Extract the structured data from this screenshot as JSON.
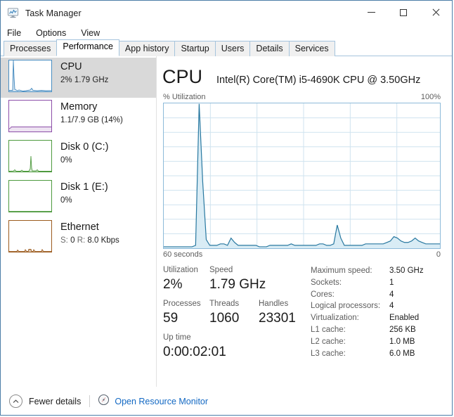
{
  "window": {
    "title": "Task Manager",
    "icon": "task-manager-icon",
    "controls": {
      "minimize": "–",
      "maximize": "☐",
      "close": "✕"
    }
  },
  "menu": {
    "items": [
      "File",
      "Options",
      "View"
    ]
  },
  "tabs": [
    {
      "label": "Processes",
      "active": false
    },
    {
      "label": "Performance",
      "active": true
    },
    {
      "label": "App history",
      "active": false
    },
    {
      "label": "Startup",
      "active": false
    },
    {
      "label": "Users",
      "active": false
    },
    {
      "label": "Details",
      "active": false
    },
    {
      "label": "Services",
      "active": false
    }
  ],
  "sidebar": {
    "items": [
      {
        "name": "CPU",
        "title": "CPU",
        "subtitle": "2%  1.79 GHz",
        "selected": true,
        "color": "#4a8ec2",
        "fill": "rgba(74,142,194,0.18)"
      },
      {
        "name": "Memory",
        "title": "Memory",
        "subtitle": "1.1/7.9 GB (14%)",
        "selected": false,
        "color": "#8c4ea8",
        "fill": "rgba(140,78,168,0.15)"
      },
      {
        "name": "Disk 0 (C:)",
        "title": "Disk 0 (C:)",
        "subtitle": "0%",
        "selected": false,
        "color": "#4e9a3e",
        "fill": "rgba(78,154,62,0.18)"
      },
      {
        "name": "Disk 1 (E:)",
        "title": "Disk 1 (E:)",
        "subtitle": "0%",
        "selected": false,
        "color": "#4e9a3e",
        "fill": "rgba(78,154,62,0.18)"
      },
      {
        "name": "Ethernet",
        "title": "Ethernet",
        "subtitle_parts": {
          "send_label": "S:",
          "send": "0",
          "recv_label": "R:",
          "recv": "8.0 Kbps"
        },
        "subtitle": "S: 0 R: 8.0 Kbps",
        "selected": false,
        "color": "#9c5b1e",
        "fill": "rgba(156,91,30,0.20)"
      }
    ]
  },
  "main": {
    "heading": "CPU",
    "model": "Intel(R) Core(TM) i5-4690K CPU @ 3.50GHz",
    "graph": {
      "y_axis_label": "% Utilization",
      "y_max_label": "100%",
      "x_left_label": "60 seconds",
      "x_right_label": "0",
      "line_color": "#2878a0",
      "fill_color": "#d9ecf5",
      "grid_color": "#cfe3ef"
    },
    "stats": {
      "row1": [
        {
          "label": "Utilization",
          "value": "2%"
        },
        {
          "label": "Speed",
          "value": "1.79 GHz"
        }
      ],
      "row2": [
        {
          "label": "Processes",
          "value": "59"
        },
        {
          "label": "Threads",
          "value": "1060"
        },
        {
          "label": "Handles",
          "value": "23301"
        }
      ],
      "row3": [
        {
          "label": "Up time",
          "value": "0:00:02:01"
        }
      ]
    },
    "specs": [
      {
        "key": "Maximum speed:",
        "value": "3.50 GHz"
      },
      {
        "key": "Sockets:",
        "value": "1"
      },
      {
        "key": "Cores:",
        "value": "4"
      },
      {
        "key": "Logical processors:",
        "value": "4"
      },
      {
        "key": "Virtualization:",
        "value": "Enabled"
      },
      {
        "key": "L1 cache:",
        "value": "256 KB"
      },
      {
        "key": "L2 cache:",
        "value": "1.0 MB"
      },
      {
        "key": "L3 cache:",
        "value": "6.0 MB"
      }
    ]
  },
  "footer": {
    "fewer_details": "Fewer details",
    "resource_monitor": "Open Resource Monitor"
  },
  "chart_data": {
    "type": "area",
    "title": "% Utilization",
    "xlabel": "60 seconds",
    "ylabel": "% Utilization",
    "ylim": [
      0,
      100
    ],
    "xlim": [
      60,
      0
    ],
    "grid": true,
    "grid_columns": 6,
    "grid_rows": 10,
    "series": [
      {
        "name": "CPU utilization",
        "color": "#2878a0",
        "values": [
          1,
          1,
          1,
          1,
          1,
          1,
          1,
          1,
          1,
          2,
          100,
          46,
          6,
          2,
          2,
          2,
          3,
          3,
          2,
          7,
          4,
          2,
          2,
          2,
          2,
          2,
          2,
          1,
          1,
          1,
          2,
          2,
          2,
          2,
          2,
          2,
          3,
          2,
          2,
          2,
          2,
          2,
          2,
          2,
          3,
          3,
          2,
          2,
          3,
          16,
          7,
          2,
          2,
          2,
          2,
          2,
          2,
          3,
          3,
          3,
          3,
          3,
          3,
          4,
          5,
          8,
          7,
          5,
          4,
          4,
          5,
          7,
          5,
          4,
          3,
          3,
          3,
          3,
          3,
          3
        ]
      }
    ]
  }
}
